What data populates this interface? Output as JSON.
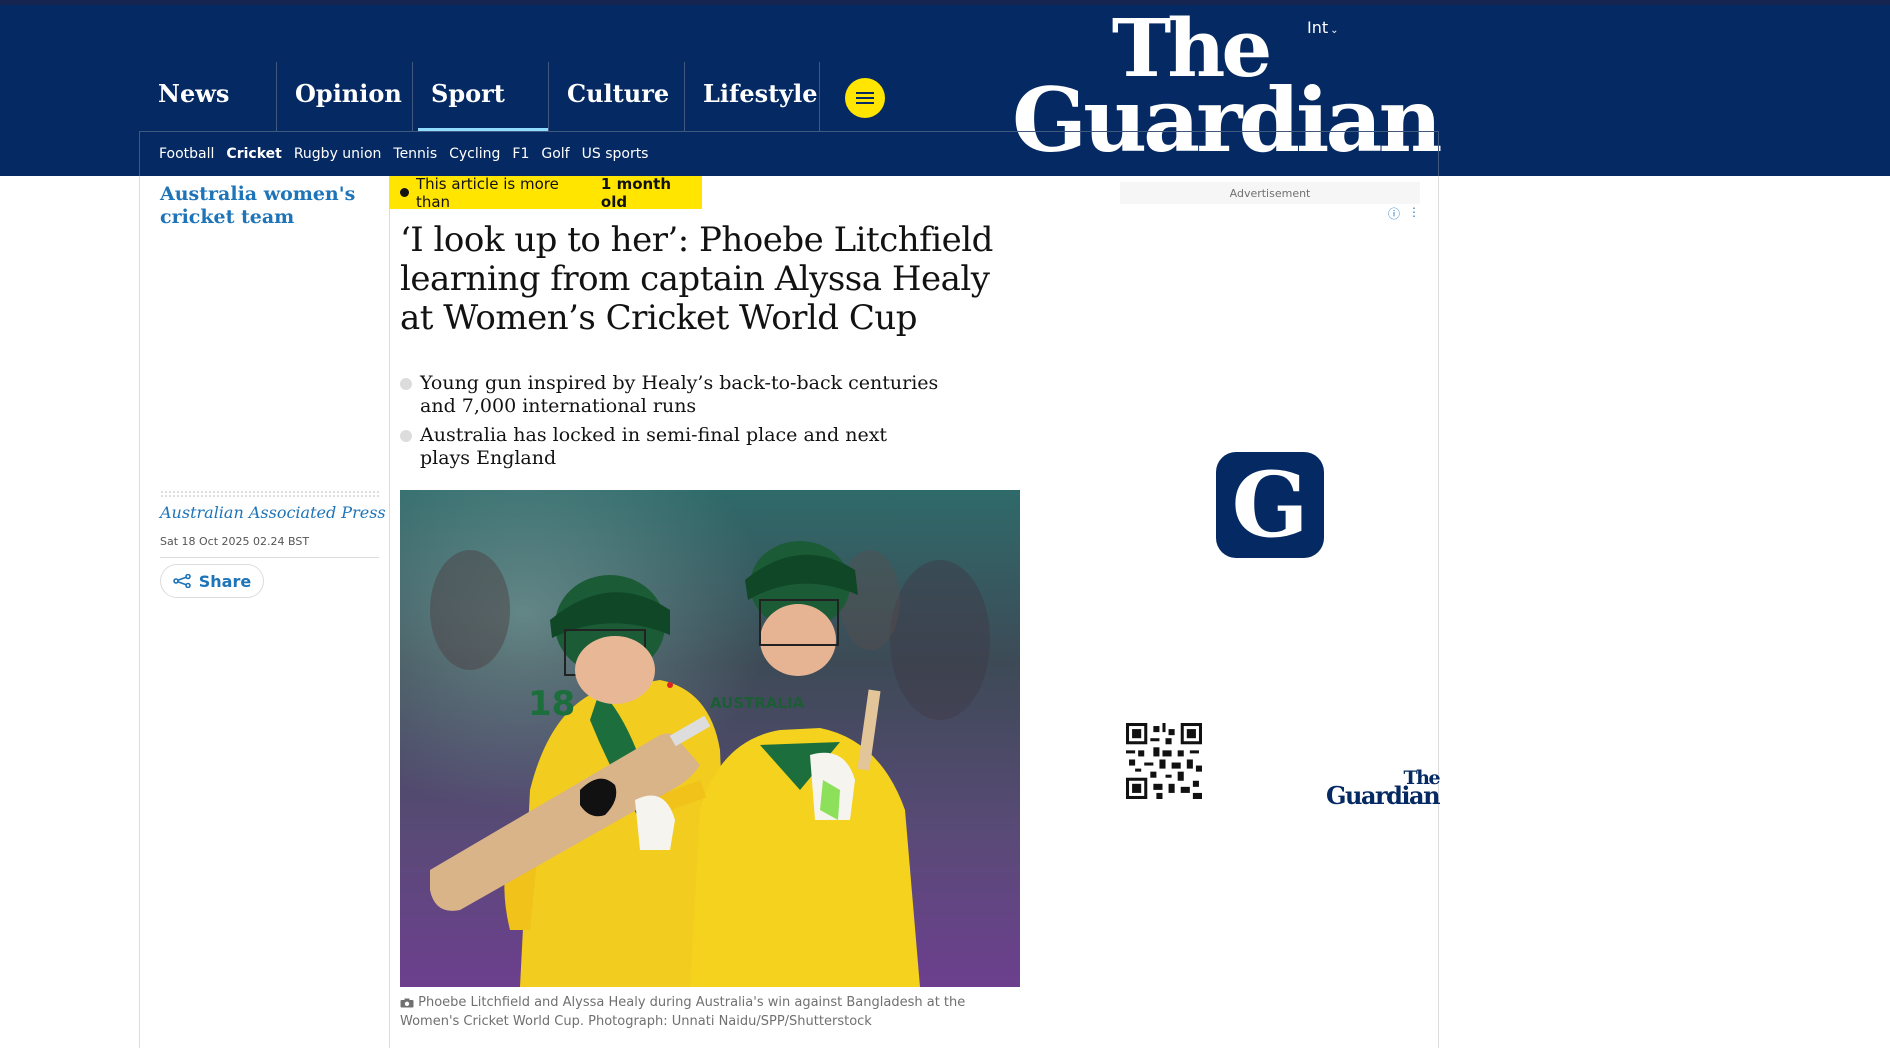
{
  "masthead": {
    "edition": "Int",
    "logo_line1": "The",
    "logo_line2": "Guardian",
    "pillars": [
      {
        "label": "News",
        "active": false
      },
      {
        "label": "Opinion",
        "active": false
      },
      {
        "label": "Sport",
        "active": true
      },
      {
        "label": "Culture",
        "active": false
      },
      {
        "label": "Lifestyle",
        "active": false
      }
    ],
    "menu_icon": "hamburger-menu-icon"
  },
  "subnav": {
    "items": [
      "Football",
      "Cricket",
      "Rugby union",
      "Tennis",
      "Cycling",
      "F1",
      "Golf",
      "US sports"
    ],
    "active": "Cricket"
  },
  "article": {
    "series": "Australia women's cricket team",
    "age_prefix": "This article is more than",
    "age_value": "1 month old",
    "headline": "‘I look up to her’: Phoebe Litchfield learning from captain Alyssa Healy at Women’s Cricket World Cup",
    "standfirst": [
      "Young gun inspired by Healy’s back-to-back centuries and 7,000 international runs",
      "Australia has locked in semi-final place and next plays England"
    ],
    "byline": "Australian Associated Press",
    "dateline": "Sat 18 Oct 2025 02.24 BST",
    "share_label": "Share",
    "photo_text": {
      "jersey_word": "AUSTRALIA",
      "jersey_number": "18"
    },
    "caption": "Phoebe Litchfield and Alyssa Healy during Australia's win against Bangladesh at the Women's Cricket World Cup. Photograph: Unnati Naidu/SPP/Shutterstock"
  },
  "advert": {
    "label": "Advertisement",
    "tile_letter": "G",
    "logo_line1": "The",
    "logo_line2": "Guardian"
  },
  "colors": {
    "brand_blue": "#052962",
    "accent_yellow": "#ffe500",
    "sport_underline": "#90dcff",
    "link_blue": "#1e74b8"
  }
}
